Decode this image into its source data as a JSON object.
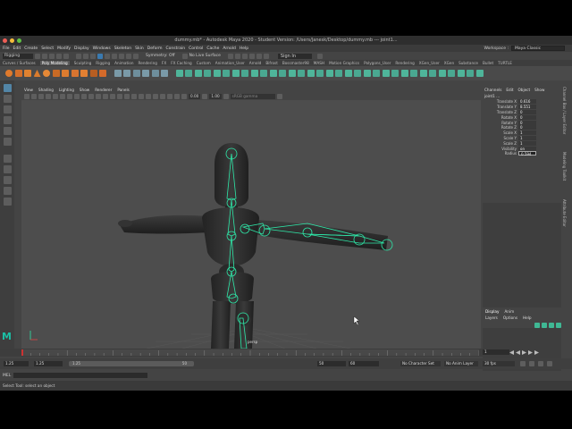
{
  "window": {
    "title": "dummy.mb* - Autodesk Maya 2020 - Student Version: /Users/Janesk/Desktop/dummy.mb  ---  joint1..."
  },
  "menubar": {
    "items": [
      "File",
      "Edit",
      "Create",
      "Select",
      "Modify",
      "Display",
      "Windows",
      "Skeleton",
      "Skin",
      "Deform",
      "Constrain",
      "Control",
      "Cache",
      "Arnold",
      "Help"
    ]
  },
  "workspace": {
    "label": "Workspace :",
    "value": "Maya Classic"
  },
  "statusline": {
    "mode": "Rigging",
    "symmetry": "Symmetry: Off",
    "live_surface": "No Live Surface",
    "sign_in": "Sign In"
  },
  "shelf": {
    "tabs": [
      "Curves / Surfaces",
      "Poly Modeling",
      "Sculpting",
      "Rigging",
      "Animation",
      "Rendering",
      "FX",
      "FX Caching",
      "Custom",
      "Animation_User",
      "Arnold",
      "Bifrost",
      "Bossmaster98",
      "MASH",
      "Motion Graphics",
      "Polygons_User",
      "Rendering",
      "XGen_User",
      "XGen",
      "Substance",
      "Bullet",
      "TURTLE"
    ],
    "active_tab": "Poly Modeling"
  },
  "viewport": {
    "menu": [
      "View",
      "Shading",
      "Lighting",
      "Show",
      "Renderer",
      "Panels"
    ],
    "near_value": "0.00",
    "scale_value": "1.00",
    "color_space": "sRGB gamma",
    "camera": "persp"
  },
  "channelbox": {
    "menu": [
      "Channels",
      "Edit",
      "Object",
      "Show"
    ],
    "node": "joint1 ...",
    "attributes": [
      {
        "name": "Translate X",
        "value": "0.616"
      },
      {
        "name": "Translate Y",
        "value": "8.551"
      },
      {
        "name": "Translate Z",
        "value": "0"
      },
      {
        "name": "Rotate X",
        "value": "0"
      },
      {
        "name": "Rotate Y",
        "value": "0"
      },
      {
        "name": "Rotate Z",
        "value": "0"
      },
      {
        "name": "Scale X",
        "value": "1"
      },
      {
        "name": "Scale Y",
        "value": "1"
      },
      {
        "name": "Scale Z",
        "value": "1"
      },
      {
        "name": "Visibility",
        "value": "on"
      },
      {
        "name": "Radius",
        "value": "0.594"
      }
    ]
  },
  "layers": {
    "tabs": [
      "Display",
      "Anim"
    ],
    "menu": [
      "Layers",
      "Options",
      "Help"
    ]
  },
  "side_tabs": [
    "Channel Box / Layer Editor",
    "Modeling Toolkit",
    "Attribute Editor"
  ],
  "timeline": {
    "start": "1.25",
    "playback_start": "1.25",
    "slider_start": "1.25",
    "slider_end": "50",
    "end_a": "50",
    "end_b": "60",
    "current_frame": "1",
    "character_set": "No Character Set",
    "anim_layer": "No Anim Layer",
    "fps": "30 fps"
  },
  "cmdline": {
    "label": "MEL"
  },
  "helpline": {
    "text": "Select Tool: select an object"
  },
  "logo": "M",
  "colors": {
    "joint": "#2ee8a8",
    "accent": "#1bbfa5",
    "viewport_bg": "#4d4d4d"
  }
}
